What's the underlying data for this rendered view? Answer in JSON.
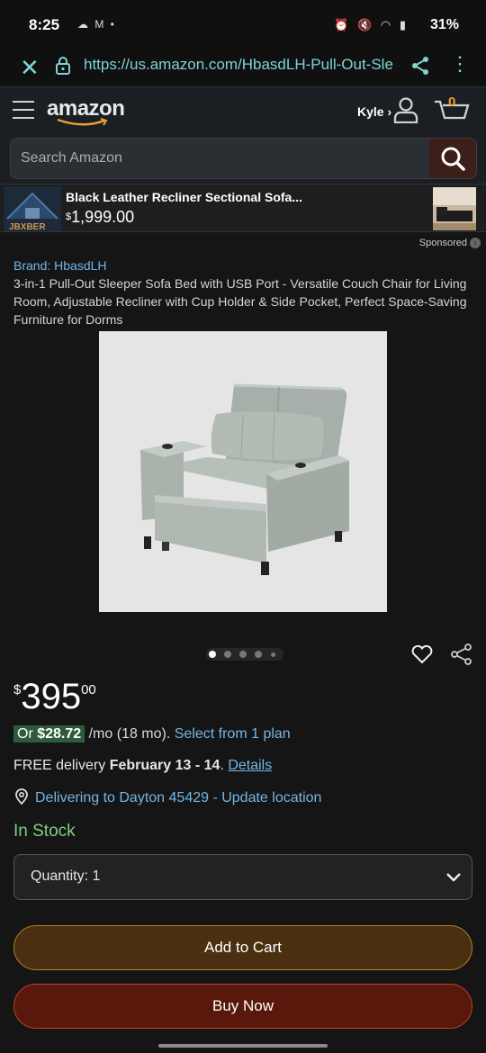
{
  "status_bar": {
    "time": "8:25",
    "battery": "31%"
  },
  "browser": {
    "url": "https://us.amazon.com/HbasdLH-Pull-Out-Sle"
  },
  "header": {
    "logo": "amazon",
    "user_label": "Kyle ›",
    "cart_count": "0"
  },
  "search": {
    "placeholder": "Search Amazon"
  },
  "sponsored_banner": {
    "brand_logo_text": "JBXBER",
    "title": "Black Leather Recliner Sectional Sofa...",
    "price_symbol": "$",
    "price": "1,999.00",
    "sponsored_label": "Sponsored"
  },
  "product": {
    "brand": "Brand: HbasdLH",
    "title": "3-in-1 Pull-Out Sleeper Sofa Bed with USB Port - Versatile Couch Chair for Living Room, Adjustable Recliner with Cup Holder & Side Pocket, Perfect Space-Saving Furniture for Dorms",
    "image_count": 5,
    "active_image": 0,
    "price_symbol": "$",
    "price_whole": "395",
    "price_fraction": "00",
    "monthly_prefix": "Or ",
    "monthly_amount": "$28.72",
    "monthly_suffix": " /mo (18 mo). ",
    "monthly_link": "Select from 1 plan",
    "delivery_prefix": "FREE delivery ",
    "delivery_date": "February 13 - 14",
    "delivery_sep": ". ",
    "delivery_link": "Details",
    "location": "Delivering to Dayton 45429 - Update location",
    "stock": "In Stock",
    "quantity_label": "Quantity:",
    "quantity_value": "1",
    "add_to_cart": "Add to Cart",
    "buy_now": "Buy Now"
  },
  "colors": {
    "link": "#72b6e6",
    "stock": "#7fd07f",
    "add_to_cart_border": "#b57e2e",
    "buy_now_border": "#b5452c"
  }
}
